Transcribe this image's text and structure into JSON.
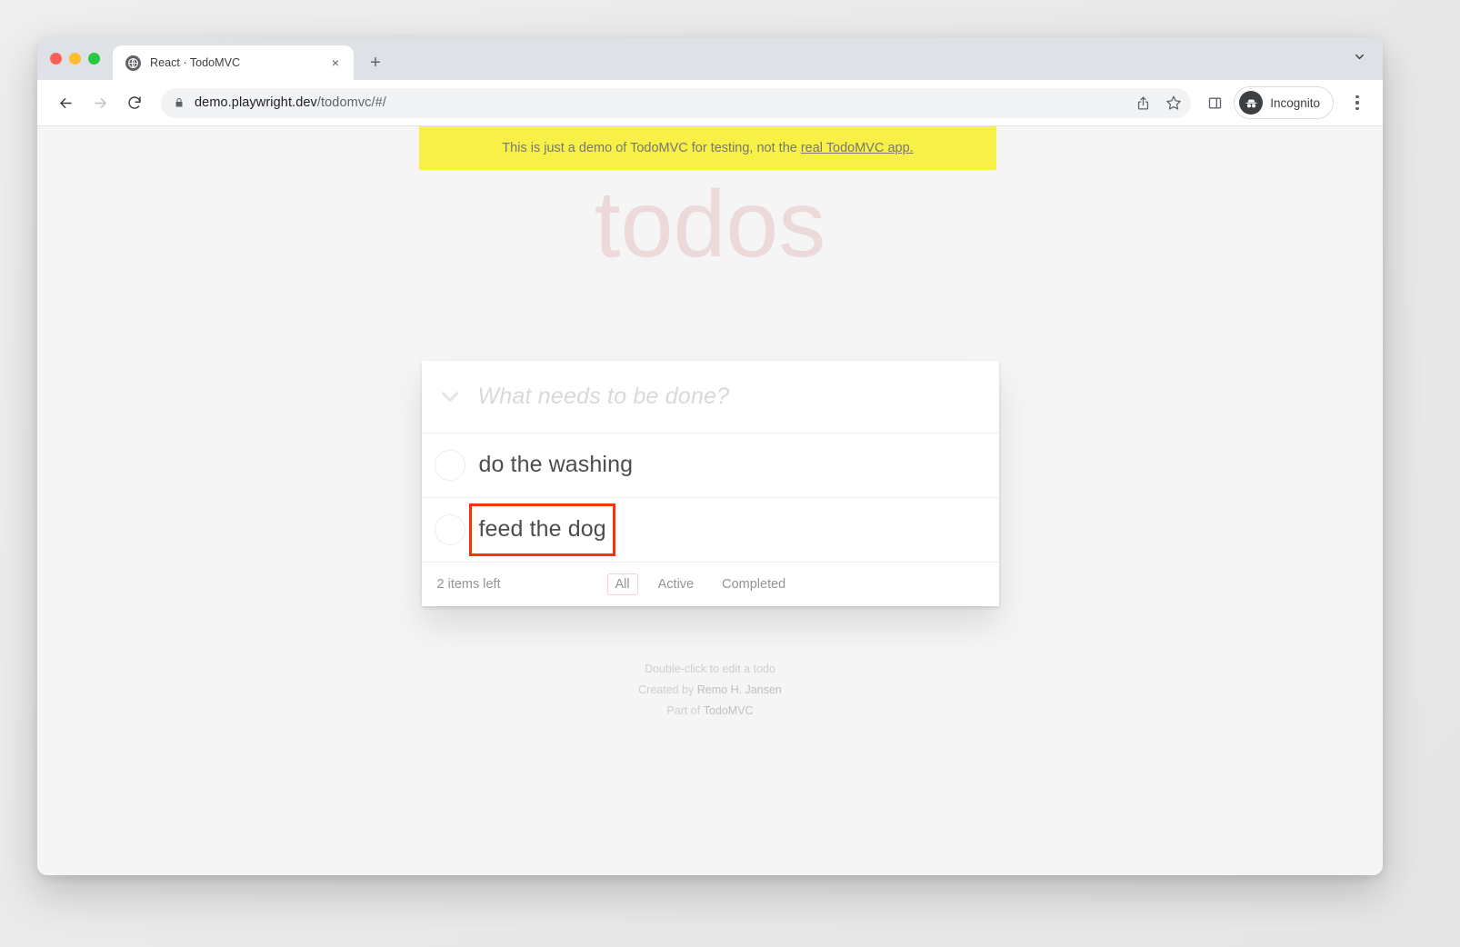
{
  "window": {
    "traffic_lights": [
      "close",
      "minimize",
      "zoom"
    ],
    "tabstrip": {
      "tab_title": "React · TodoMVC",
      "tab_close_label": "×",
      "new_tab_label": "+",
      "tab_list_chevron": "chevron-down"
    },
    "toolbar": {
      "back_label": "←",
      "forward_label": "→",
      "reload_label": "↻",
      "url_domain": "demo.playwright.dev",
      "url_path": "/todomvc/#/",
      "incognito_label": "Incognito"
    }
  },
  "page": {
    "banner": {
      "text": "This is just a demo of TodoMVC for testing, not the",
      "link_text": "real TodoMVC app."
    },
    "title": "todos",
    "new_todo": {
      "placeholder": "What needs to be done?",
      "value": ""
    },
    "todos": [
      {
        "label": "do the washing",
        "completed": false,
        "highlighted": false
      },
      {
        "label": "feed the dog",
        "completed": false,
        "highlighted": true
      }
    ],
    "footer": {
      "count_text": "2 items left",
      "filters": [
        {
          "label": "All",
          "selected": true
        },
        {
          "label": "Active",
          "selected": false
        },
        {
          "label": "Completed",
          "selected": false
        }
      ]
    },
    "info": {
      "line1": "Double-click to edit a todo",
      "line2_prefix": "Created by ",
      "line2_author": "Remo H. Jansen",
      "line3_prefix": "Part of ",
      "line3_project": "TodoMVC"
    }
  },
  "colors": {
    "banner_bg": "#f7f046",
    "title": "#ecd9d9",
    "highlight": "#f5330c",
    "filter_selected_border": "#f3d3d3"
  }
}
